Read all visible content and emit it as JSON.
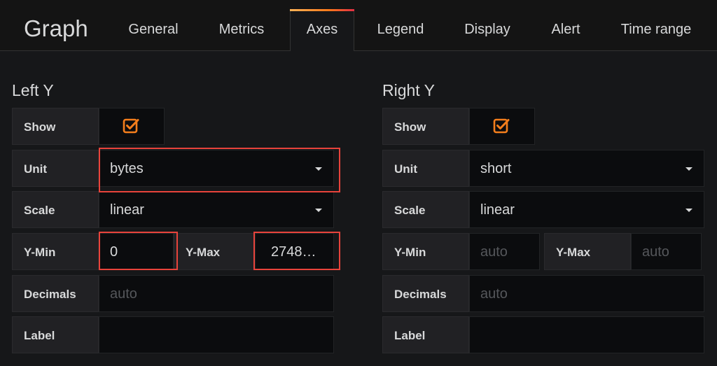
{
  "header": {
    "title": "Graph",
    "tabs": [
      "General",
      "Metrics",
      "Axes",
      "Legend",
      "Display",
      "Alert",
      "Time range"
    ],
    "active_tab": "Axes",
    "accent": "#ff7a1a"
  },
  "left_y": {
    "title": "Left Y",
    "show_label": "Show",
    "show_checked": true,
    "unit_label": "Unit",
    "unit_value": "bytes",
    "scale_label": "Scale",
    "scale_value": "linear",
    "ymin_label": "Y-Min",
    "ymin_value": "0",
    "ymax_label": "Y-Max",
    "ymax_value": "2748…",
    "decimals_label": "Decimals",
    "decimals_placeholder": "auto",
    "label_label": "Label",
    "label_value": ""
  },
  "right_y": {
    "title": "Right Y",
    "show_label": "Show",
    "show_checked": true,
    "unit_label": "Unit",
    "unit_value": "short",
    "scale_label": "Scale",
    "scale_value": "linear",
    "ymin_label": "Y-Min",
    "ymin_placeholder": "auto",
    "ymax_label": "Y-Max",
    "ymax_placeholder": "auto",
    "decimals_label": "Decimals",
    "decimals_placeholder": "auto",
    "label_label": "Label",
    "label_value": ""
  },
  "colors": {
    "checkbox": "#f47e1c",
    "highlight": "#e8433b"
  }
}
